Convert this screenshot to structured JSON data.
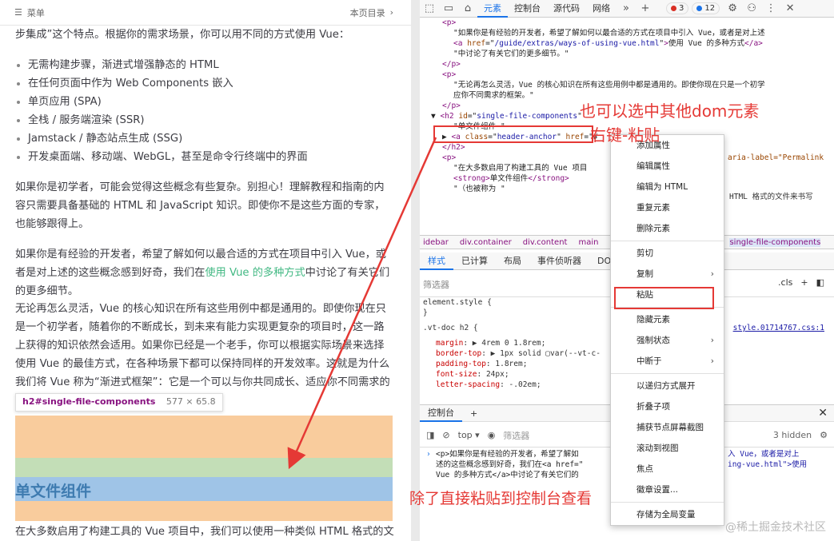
{
  "left": {
    "menu_label": "菜单",
    "on_page_label": "本页目录",
    "p_intro": "步集成”这个特点。根据你的需求场景，你可以用不同的方式使用 Vue：",
    "list": [
      "无需构建步骤，渐进式增强静态的 HTML",
      "在任何页面中作为 Web Components 嵌入",
      "单页应用 (SPA)",
      "全栈 / 服务端渲染 (SSR)",
      "Jamstack / 静态站点生成 (SSG)",
      "开发桌面端、移动端、WebGL，甚至是命令行终端中的界面"
    ],
    "p_beginner": "如果你是初学者，可能会觉得这些概念有些复杂。别担心！理解教程和指南的内容只需要具备基础的 HTML 和 JavaScript 知识。即使你不是这些方面的专家，也能够跟得上。",
    "p_exp_before": "如果你是有经验的开发者，希望了解如何以最合适的方式在项目中引入 Vue，或者是对上述的这些概念感到好奇，我们在",
    "p_exp_link": "使用 Vue 的多种方式",
    "p_exp_after": "中讨论了有关它们的更多细节。",
    "p_flex": "无论再怎么灵活，Vue 的核心知识在所有这些用例中都是通用的。即使你现在只是一个初学者，随着你的不断成长，到未来有能力实现更复杂的项目时，这一路上获得的知识依然会适用。如果你已经是一个老手，你可以根据实际场景来选择使用 Vue 的最佳方式，在各种场景下都可以保持同样的开发效率。这就是为什么我们将 Vue 称为“渐进式框架”：它是一个可以与你共同成长、适应你不同需求的框架。",
    "tooltip_tag": "h2#single-file-components",
    "tooltip_dim": "577 × 65.8",
    "h2_title": "单文件组件",
    "last_line": "在大多数启用了构建工具的 Vue 项目中，我们可以使用一种类似 HTML 格式的文"
  },
  "devtools": {
    "tabs": [
      "元素",
      "控制台",
      "源代码",
      "网络"
    ],
    "errors": "3",
    "messages": "12",
    "dom_lines": [
      {
        "indent": 2,
        "html": "<span class='tg'>&lt;p&gt;</span>"
      },
      {
        "indent": 3,
        "html": "\"如果你是有经验的开发者，希望了解如何以最合适的方式在项目中引入 Vue，或者是对上述"
      },
      {
        "indent": 3,
        "html": "<span class='tg'>&lt;a</span> <span class='at'>href</span>=\"<span class='av'>/guide/extras/ways-of-using-vue.html</span>\"<span class='tg'>&gt;</span>使用 Vue 的多种方式<span class='tg'>&lt;/a&gt;</span>"
      },
      {
        "indent": 3,
        "html": "\"中讨论了有关它们的更多细节。\""
      },
      {
        "indent": 2,
        "html": "<span class='tg'>&lt;/p&gt;</span>"
      },
      {
        "indent": 2,
        "html": "<span class='tg'>&lt;p&gt;</span>"
      },
      {
        "indent": 3,
        "html": "\"无论再怎么灵活，Vue 的核心知识在所有这些用例中都是通用的。即使你现在只是一个初学"
      },
      {
        "indent": 3,
        "html": "应你不同需求的框架。\""
      },
      {
        "indent": 2,
        "html": "<span class='tg'>&lt;/p&gt;</span>"
      },
      {
        "indent": 1,
        "html": "▼ <span class='tg'>&lt;h2</span> <span class='at'>id</span>=\"<span class='av'>single-file-components</span>\""
      },
      {
        "indent": 3,
        "html": "\"单文件组件 \""
      },
      {
        "indent": 2,
        "html": "▶ <span class='tg'>&lt;a</span> <span class='at'>class</span>=\"<span class='av'>header-anchor</span>\" <span class='at'>href</span>=\"#"
      },
      {
        "indent": 2,
        "html": "<span class='tg'>&lt;/h2&gt;</span>"
      },
      {
        "indent": 2,
        "html": "<span class='tg'>&lt;p&gt;</span>"
      },
      {
        "indent": 3,
        "html": "\"在大多数启用了构建工具的 Vue 项目"
      },
      {
        "indent": 3,
        "html": "<span class='tg'>&lt;strong&gt;</span>单文件组件<span class='tg'>&lt;/strong&gt;</span>"
      },
      {
        "indent": 3,
        "html": "\"（也被称为 \""
      }
    ],
    "dom_right_fragments": {
      "aria": "aria-label=\"Permalink",
      "html_frag": "HTML 格式的文件来书写"
    },
    "crumbs": [
      "idebar",
      "div.container",
      "div.content",
      "main",
      "single-file-components"
    ],
    "style_tabs": [
      "样式",
      "已计算",
      "布局",
      "事件侦听器",
      "DOM"
    ],
    "filter_placeholder": "筛选器",
    "cls_label": ".cls",
    "styles": {
      "element_style": "element.style {",
      "close": "}",
      "selector": ".vt-doc h2 {",
      "source": "style.01714767.css:1",
      "props": [
        {
          "name": "margin",
          "value": "▶ 4rem 0 1.8rem;"
        },
        {
          "name": "border-top",
          "value": "▶ 1px solid ▢var(--vt-c-"
        },
        {
          "name": "padding-top",
          "value": "1.8rem;"
        },
        {
          "name": "font-size",
          "value": "24px;"
        },
        {
          "name": "letter-spacing",
          "value": "-.02em;"
        }
      ]
    },
    "console_tab": "控制台",
    "console_level": "top",
    "console_filter": "筛选器",
    "hidden_count": "3 hidden",
    "console_lines": [
      "<p>如果你是有经验的开发者，希望了解如",
      "述的这些概念感到好奇，我们在<a href=\"",
      "Vue 的多种方式</a>中讨论了有关它们的"
    ],
    "console_right": [
      "入 Vue，或者是对上",
      "ing-vue.html\">使用"
    ]
  },
  "context_menu": {
    "items": [
      {
        "label": "添加属性",
        "submenu": false
      },
      {
        "label": "编辑属性",
        "submenu": false
      },
      {
        "label": "编辑为 HTML",
        "submenu": false
      },
      {
        "label": "重复元素",
        "submenu": false
      },
      {
        "label": "删除元素",
        "submenu": false
      },
      {
        "sep": true
      },
      {
        "label": "剪切",
        "submenu": false
      },
      {
        "label": "复制",
        "submenu": true
      },
      {
        "label": "粘贴",
        "submenu": false
      },
      {
        "sep": true
      },
      {
        "label": "隐藏元素",
        "submenu": false
      },
      {
        "label": "强制状态",
        "submenu": true
      },
      {
        "label": "中断于",
        "submenu": true
      },
      {
        "sep": true
      },
      {
        "label": "以递归方式展开",
        "submenu": false
      },
      {
        "label": "折叠子项",
        "submenu": false
      },
      {
        "label": "捕获节点屏幕截图",
        "submenu": false
      },
      {
        "label": "滚动到视图",
        "submenu": false
      },
      {
        "label": "焦点",
        "submenu": false
      },
      {
        "label": "徽章设置...",
        "submenu": false
      },
      {
        "sep": true
      },
      {
        "label": "存储为全局变量",
        "submenu": false
      }
    ]
  },
  "annotations": {
    "other_dom": "也可以选中其他dom元素",
    "right_click_paste": "右键-粘贴",
    "console_note": "除了直接粘贴到控制台查看"
  },
  "watermark": "@稀土掘金技术社区",
  "colors": {
    "annotation": "#e53935",
    "link": "#42b883",
    "accent": "#1a73e8"
  }
}
